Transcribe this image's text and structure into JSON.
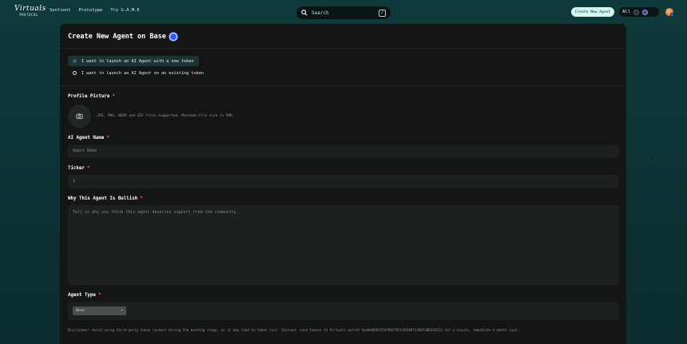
{
  "header": {
    "logo_text": "Virtuals",
    "logo_sub": "PROTOCOL",
    "nav": [
      "Sentient",
      "Prototype",
      "Try G.A.M.E"
    ],
    "search_label": "Search",
    "search_shortcut": "/",
    "create_button": "Create New Agent",
    "chain_filter": "All",
    "icons": [
      "search-icon",
      "chain-icon",
      "avatar"
    ]
  },
  "form": {
    "title": "Create New Agent on Base",
    "options": [
      "I want to launch an AI Agent with a new token",
      "I want to launch an AI Agent on an existing token"
    ],
    "selected_option": 0,
    "profile_picture": {
      "label": "Profile Picture",
      "hint": ".JPG, PNG, WEBP and GIF files supported. Maximum file size is 5MB."
    },
    "agent_name": {
      "label": "AI Agent Name",
      "placeholder": "Agent Name"
    },
    "ticker": {
      "label": "Ticker",
      "placeholder": "$"
    },
    "bullish": {
      "label": "Why This Agent Is Bullish",
      "placeholder": "Tell us why you think this agent deserves support from the community."
    },
    "agent_type": {
      "label": "Agent Type",
      "value": "None"
    },
    "required_mark": "*",
    "disclaimer": "Disclaimer: Avoid using third-party token lockers during the bonding stage, as it may lead to token loss. Instead, send tokens to Virtuals wallet 0xdAd86925f0f06278fe35D40f1200fa8D1A2E33 for a secure, immediate 6-month lock."
  },
  "colors": {
    "background": "#0f3a3c",
    "card": "#141616",
    "accent": "#d6f7ef",
    "required": "#ff5a5a",
    "base_blue": "#2f5bff"
  }
}
